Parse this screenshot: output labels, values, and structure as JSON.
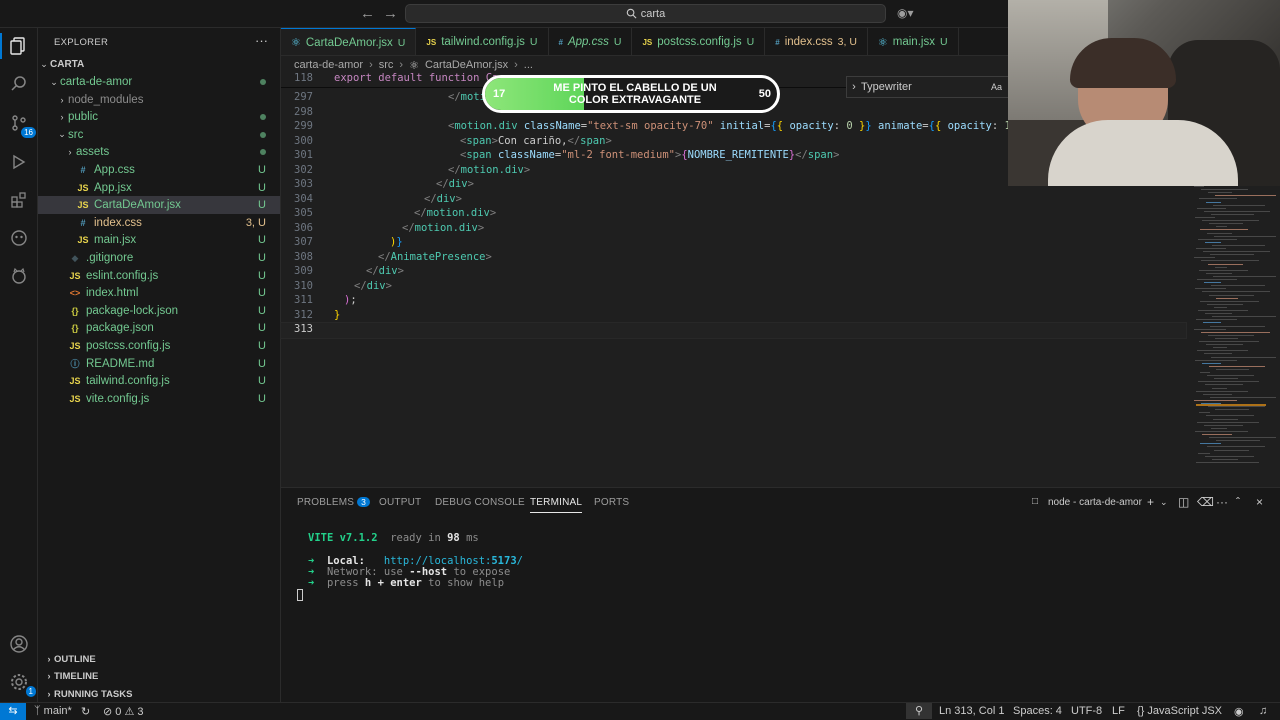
{
  "titlebar": {
    "search_text": "carta"
  },
  "activity": {
    "source_control_badge": "16",
    "account_badge": "1"
  },
  "sidebar": {
    "title": "EXPLORER",
    "root": "CARTA",
    "items": [
      {
        "label": "carta-de-amor",
        "status": "",
        "kind": "folder-open"
      },
      {
        "label": "node_modules",
        "status": "",
        "kind": "folder"
      },
      {
        "label": "public",
        "status": "",
        "kind": "folder"
      },
      {
        "label": "src",
        "status": "",
        "kind": "folder-open"
      },
      {
        "label": "assets",
        "status": "",
        "kind": "folder"
      },
      {
        "label": "App.css",
        "status": "U",
        "kind": "file"
      },
      {
        "label": "App.jsx",
        "status": "U",
        "kind": "file"
      },
      {
        "label": "CartaDeAmor.jsx",
        "status": "U",
        "kind": "file"
      },
      {
        "label": "index.css",
        "status": "3, U",
        "kind": "file"
      },
      {
        "label": "main.jsx",
        "status": "U",
        "kind": "file"
      },
      {
        "label": ".gitignore",
        "status": "U",
        "kind": "file"
      },
      {
        "label": "eslint.config.js",
        "status": "U",
        "kind": "file"
      },
      {
        "label": "index.html",
        "status": "U",
        "kind": "file"
      },
      {
        "label": "package-lock.json",
        "status": "U",
        "kind": "file"
      },
      {
        "label": "package.json",
        "status": "U",
        "kind": "file"
      },
      {
        "label": "postcss.config.js",
        "status": "U",
        "kind": "file"
      },
      {
        "label": "README.md",
        "status": "U",
        "kind": "file"
      },
      {
        "label": "tailwind.config.js",
        "status": "U",
        "kind": "file"
      },
      {
        "label": "vite.config.js",
        "status": "U",
        "kind": "file"
      }
    ],
    "sections": [
      "OUTLINE",
      "TIMELINE",
      "RUNNING TASKS"
    ]
  },
  "tabs": [
    {
      "label": "CartaDeAmor.jsx",
      "status": "U"
    },
    {
      "label": "tailwind.config.js",
      "status": "U"
    },
    {
      "label": "App.css",
      "status": "U"
    },
    {
      "label": "postcss.config.js",
      "status": "U"
    },
    {
      "label": "index.css",
      "status": "3, U"
    },
    {
      "label": "main.jsx",
      "status": "U"
    }
  ],
  "breadcrumb": [
    "carta-de-amor",
    "src",
    "CartaDeAmor.jsx",
    "..."
  ],
  "editor": {
    "sticky_line": "118",
    "sticky_text": "export default function Ca",
    "lines": [
      "297",
      "298",
      "299",
      "300",
      "301",
      "302",
      "303",
      "304",
      "305",
      "306",
      "307",
      "308",
      "309",
      "310",
      "311",
      "312",
      "313"
    ]
  },
  "find": {
    "value": "Typewriter",
    "option": "Aa"
  },
  "overlay": {
    "left_number": "17",
    "right_number": "50",
    "text": "ME PINTO EL CABELLO DE UN COLOR EXTRAVAGANTE",
    "progress": 0.34
  },
  "panel": {
    "tabs": [
      "PROBLEMS",
      "OUTPUT",
      "DEBUG CONSOLE",
      "TERMINAL",
      "PORTS"
    ],
    "problems_count": "3",
    "terminal_name": "node - carta-de-amor",
    "vite_version": "VITE v7.1.2",
    "ready": "ready in",
    "ready_ms": "98",
    "ms": "ms",
    "local_label": "Local:",
    "local_url_prefix": "http://localhost:",
    "local_port": "5173",
    "local_url_suffix": "/",
    "network_label": "Network:",
    "network_use": "use",
    "network_flag": "--host",
    "network_suffix": "to expose",
    "press": "press",
    "press_key": "h + enter",
    "press_suffix": "to show help"
  },
  "statusbar": {
    "branch": "main*",
    "errors": "0",
    "warnings": "3",
    "position": "Ln 313, Col 1",
    "spaces": "Spaces: 4",
    "encoding": "UTF-8",
    "eol": "LF",
    "language": "JavaScript JSX"
  },
  "colors": {
    "accent": "#0078d4",
    "untracked": "#73c991",
    "modified": "#e2c08d",
    "pill_green": "#6ddc64"
  }
}
